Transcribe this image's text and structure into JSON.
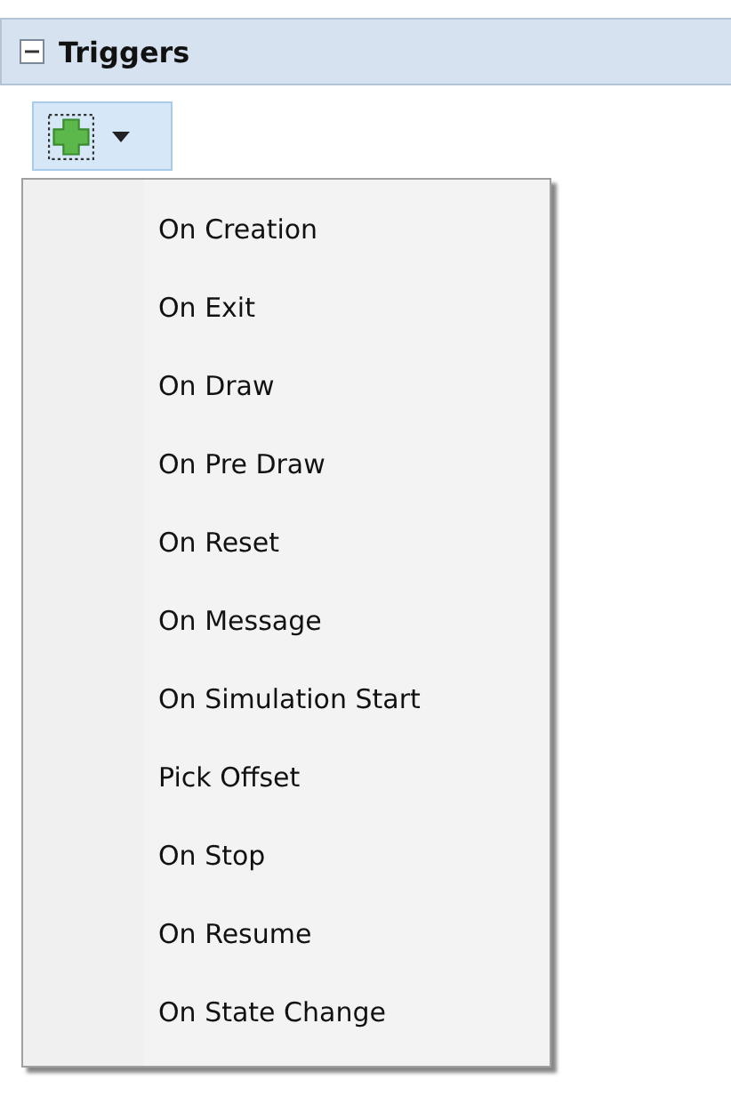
{
  "section": {
    "title": "Triggers",
    "expanded": true
  },
  "toolbar": {
    "add_button": {
      "has_dropdown": true
    }
  },
  "menu": {
    "items": [
      {
        "label": "On Creation"
      },
      {
        "label": "On Exit"
      },
      {
        "label": "On Draw"
      },
      {
        "label": "On Pre Draw"
      },
      {
        "label": "On Reset"
      },
      {
        "label": "On Message"
      },
      {
        "label": "On Simulation Start"
      },
      {
        "label": "Pick Offset"
      },
      {
        "label": "On Stop"
      },
      {
        "label": "On Resume"
      },
      {
        "label": "On State Change"
      }
    ]
  }
}
